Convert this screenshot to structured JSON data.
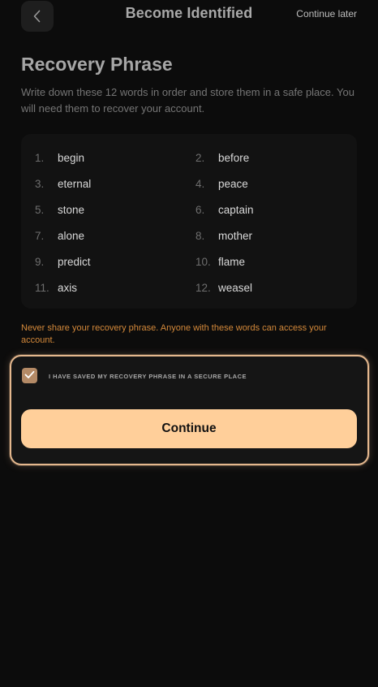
{
  "header": {
    "back_icon": "chevron-left-icon",
    "title": "Become Identified",
    "continue_later": "Continue later"
  },
  "page": {
    "title": "Recovery Phrase",
    "description": "Write down these 12 words in order and store them in a safe place. You will need them to recover your account."
  },
  "phrase": [
    {
      "num": "1.",
      "word": "begin"
    },
    {
      "num": "2.",
      "word": "before"
    },
    {
      "num": "3.",
      "word": "eternal"
    },
    {
      "num": "4.",
      "word": "peace"
    },
    {
      "num": "5.",
      "word": "stone"
    },
    {
      "num": "6.",
      "word": "captain"
    },
    {
      "num": "7.",
      "word": "alone"
    },
    {
      "num": "8.",
      "word": "mother"
    },
    {
      "num": "9.",
      "word": "predict"
    },
    {
      "num": "10.",
      "word": "flame"
    },
    {
      "num": "11.",
      "word": "axis"
    },
    {
      "num": "12.",
      "word": "weasel"
    }
  ],
  "warning": "Never share your recovery phrase. Anyone with these words can access your account.",
  "confirm": {
    "checked": true,
    "check_icon": "checkmark-icon",
    "label": "I have saved my recovery phrase in a secure place",
    "button_label": "Continue"
  },
  "colors": {
    "background": "#0c0c0c",
    "accent": "#ffcf9a",
    "warning": "#d4893a",
    "checkbox": "#b48a66"
  }
}
